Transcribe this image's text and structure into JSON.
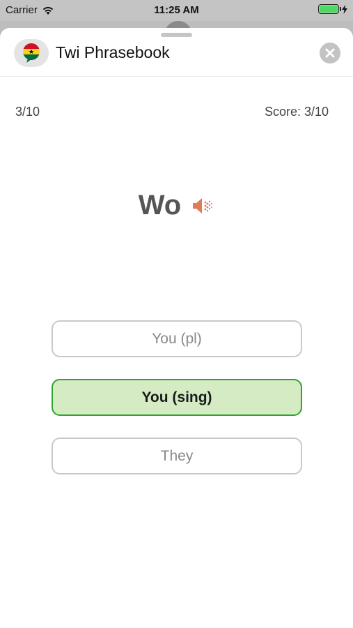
{
  "status_bar": {
    "carrier": "Carrier",
    "time": "11:25 AM",
    "battery_level": 1.0,
    "battery_color": "#4cd964"
  },
  "header": {
    "title": "Twi Phrasebook",
    "app_icon": "ghana-flag-speech-bubble-icon",
    "close_icon": "close-icon"
  },
  "quiz": {
    "progress": "3/10",
    "score": "Score: 3/10",
    "word": "Wo",
    "speaker_icon": "speaker-icon",
    "speaker_color": "#e07b54",
    "options": [
      {
        "label": "You (pl)",
        "state": "default"
      },
      {
        "label": "You (sing)",
        "state": "correct"
      },
      {
        "label": "They",
        "state": "default"
      }
    ],
    "correct_color": "#2ea52c",
    "correct_bg": "#d4ebc3"
  }
}
